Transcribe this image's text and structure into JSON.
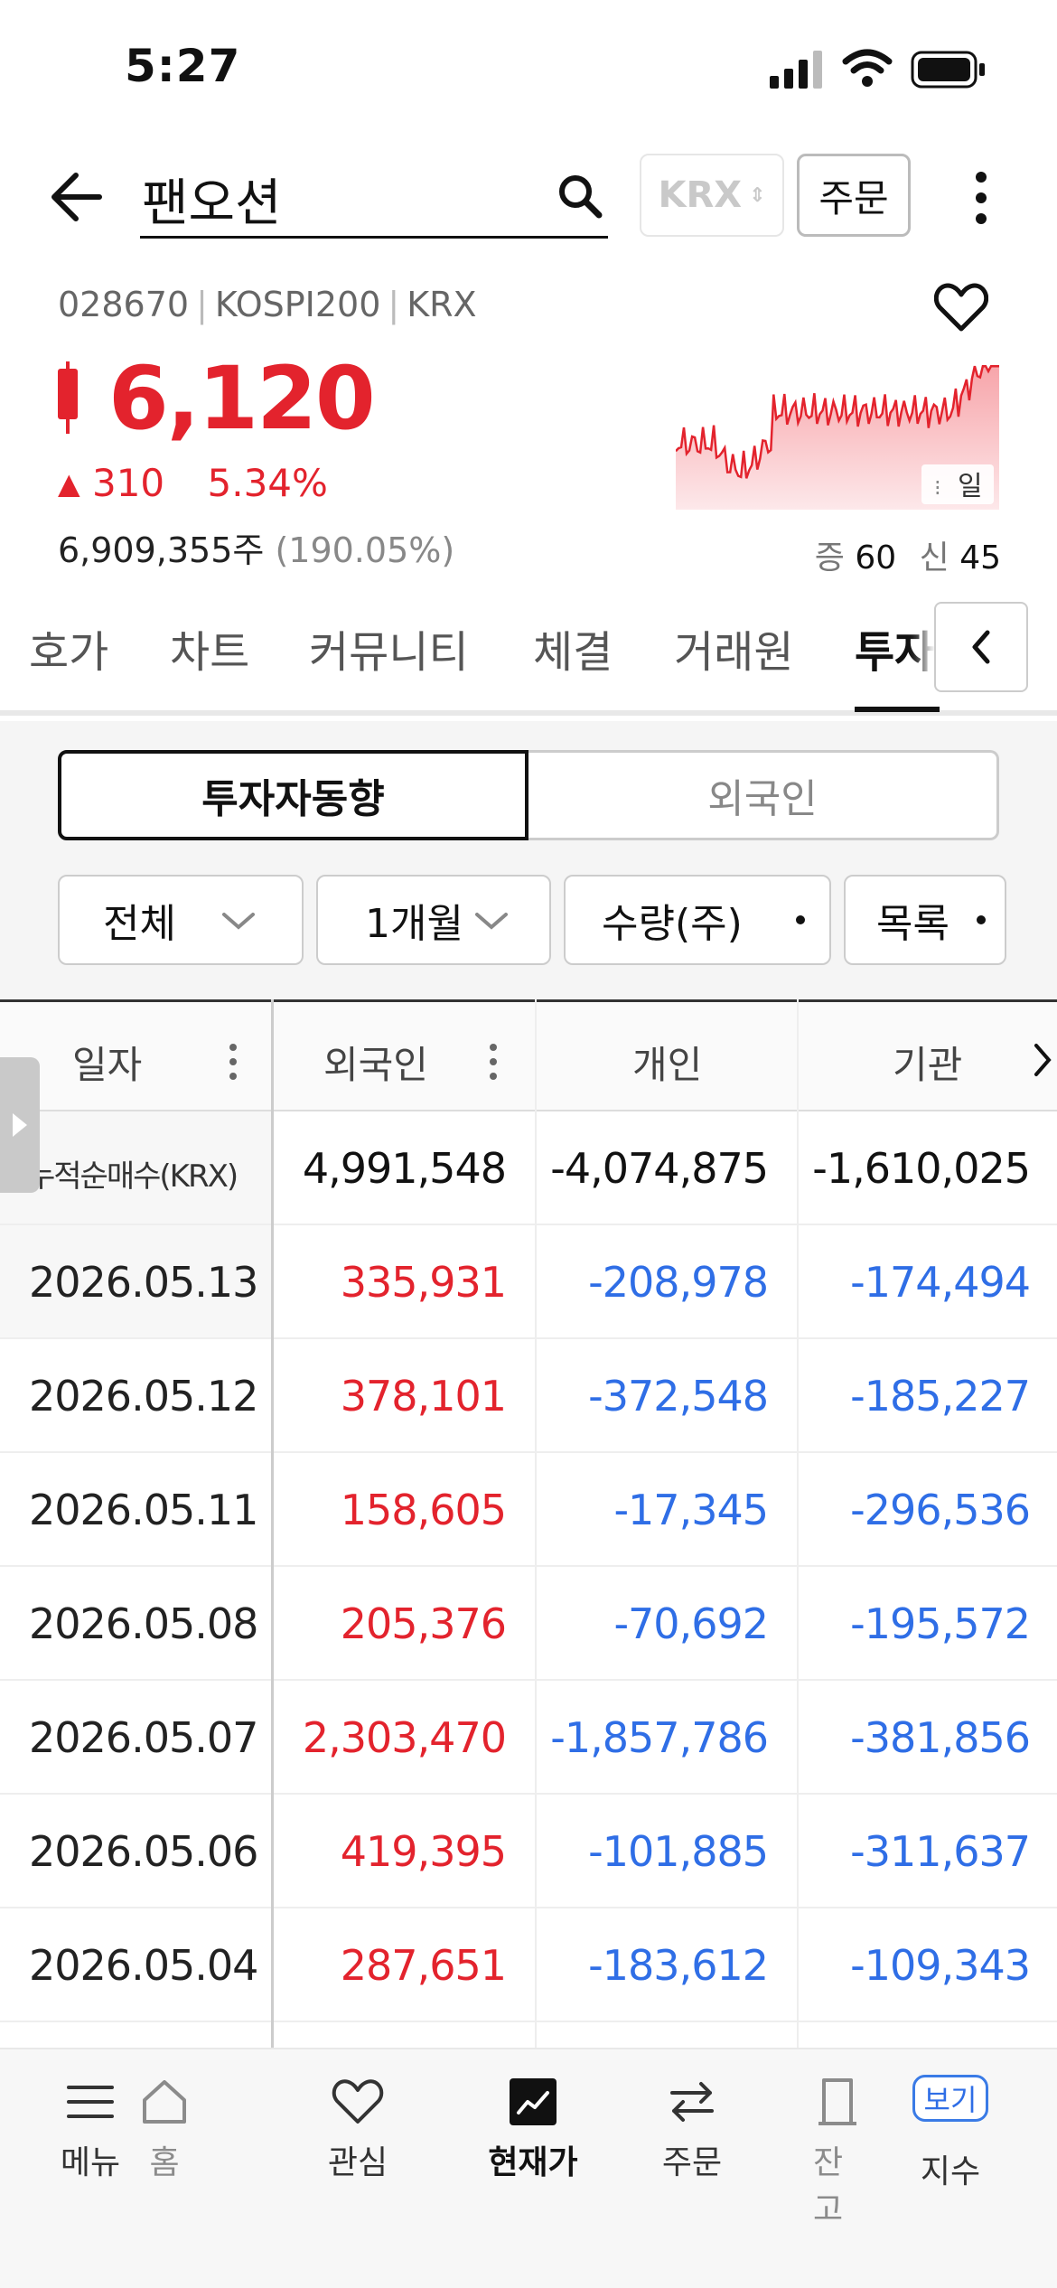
{
  "status_bar": {
    "time": "5:27"
  },
  "header": {
    "stock_name": "팬오션",
    "exchange": "KRX",
    "order_label": "주문"
  },
  "meta": {
    "code": "028670",
    "index": "KOSPI200",
    "market": "KRX"
  },
  "quote": {
    "price": "6,120",
    "change": "310",
    "change_pct": "5.34%",
    "volume": "6,909,355주",
    "volume_ratio": "(190.05%)",
    "margin_label_1": "증",
    "margin_value_1": "60",
    "margin_label_2": "신",
    "margin_value_2": "45",
    "chart_period": "일"
  },
  "tabs": [
    "호가",
    "차트",
    "커뮤니티",
    "체결",
    "거래원",
    "투자"
  ],
  "segment": {
    "active": "투자자동향",
    "inactive": "외국인"
  },
  "filters": {
    "type": "전체",
    "period": "1개월",
    "unit": "수량(주)",
    "view": "목록"
  },
  "table": {
    "headers": [
      "일자",
      "외국인",
      "개인",
      "기관"
    ],
    "summary": {
      "label": "누적순매수(KRX)",
      "foreign": "4,991,548",
      "individual": "-4,074,875",
      "institution": "-1,610,025"
    },
    "rows": [
      {
        "date": "2026.05.13",
        "foreign": "335,931",
        "individual": "-208,978",
        "institution": "-174,494"
      },
      {
        "date": "2026.05.12",
        "foreign": "378,101",
        "individual": "-372,548",
        "institution": "-185,227"
      },
      {
        "date": "2026.05.11",
        "foreign": "158,605",
        "individual": "-17,345",
        "institution": "-296,536"
      },
      {
        "date": "2026.05.08",
        "foreign": "205,376",
        "individual": "-70,692",
        "institution": "-195,572"
      },
      {
        "date": "2026.05.07",
        "foreign": "2,303,470",
        "individual": "-1,857,786",
        "institution": "-381,856"
      },
      {
        "date": "2026.05.06",
        "foreign": "419,395",
        "individual": "-101,885",
        "institution": "-311,637"
      },
      {
        "date": "2026.05.04",
        "foreign": "287,651",
        "individual": "-183,612",
        "institution": "-109,343"
      }
    ]
  },
  "bottom_nav": {
    "menu": "메뉴",
    "home": "홈",
    "watch": "관심",
    "current": "현재가",
    "order": "주문",
    "balance": "잔고",
    "index": "지수",
    "more_badge": "보기"
  },
  "colors": {
    "up": "#e3232d",
    "down": "#2f6ee6",
    "active_border": "#111111"
  }
}
